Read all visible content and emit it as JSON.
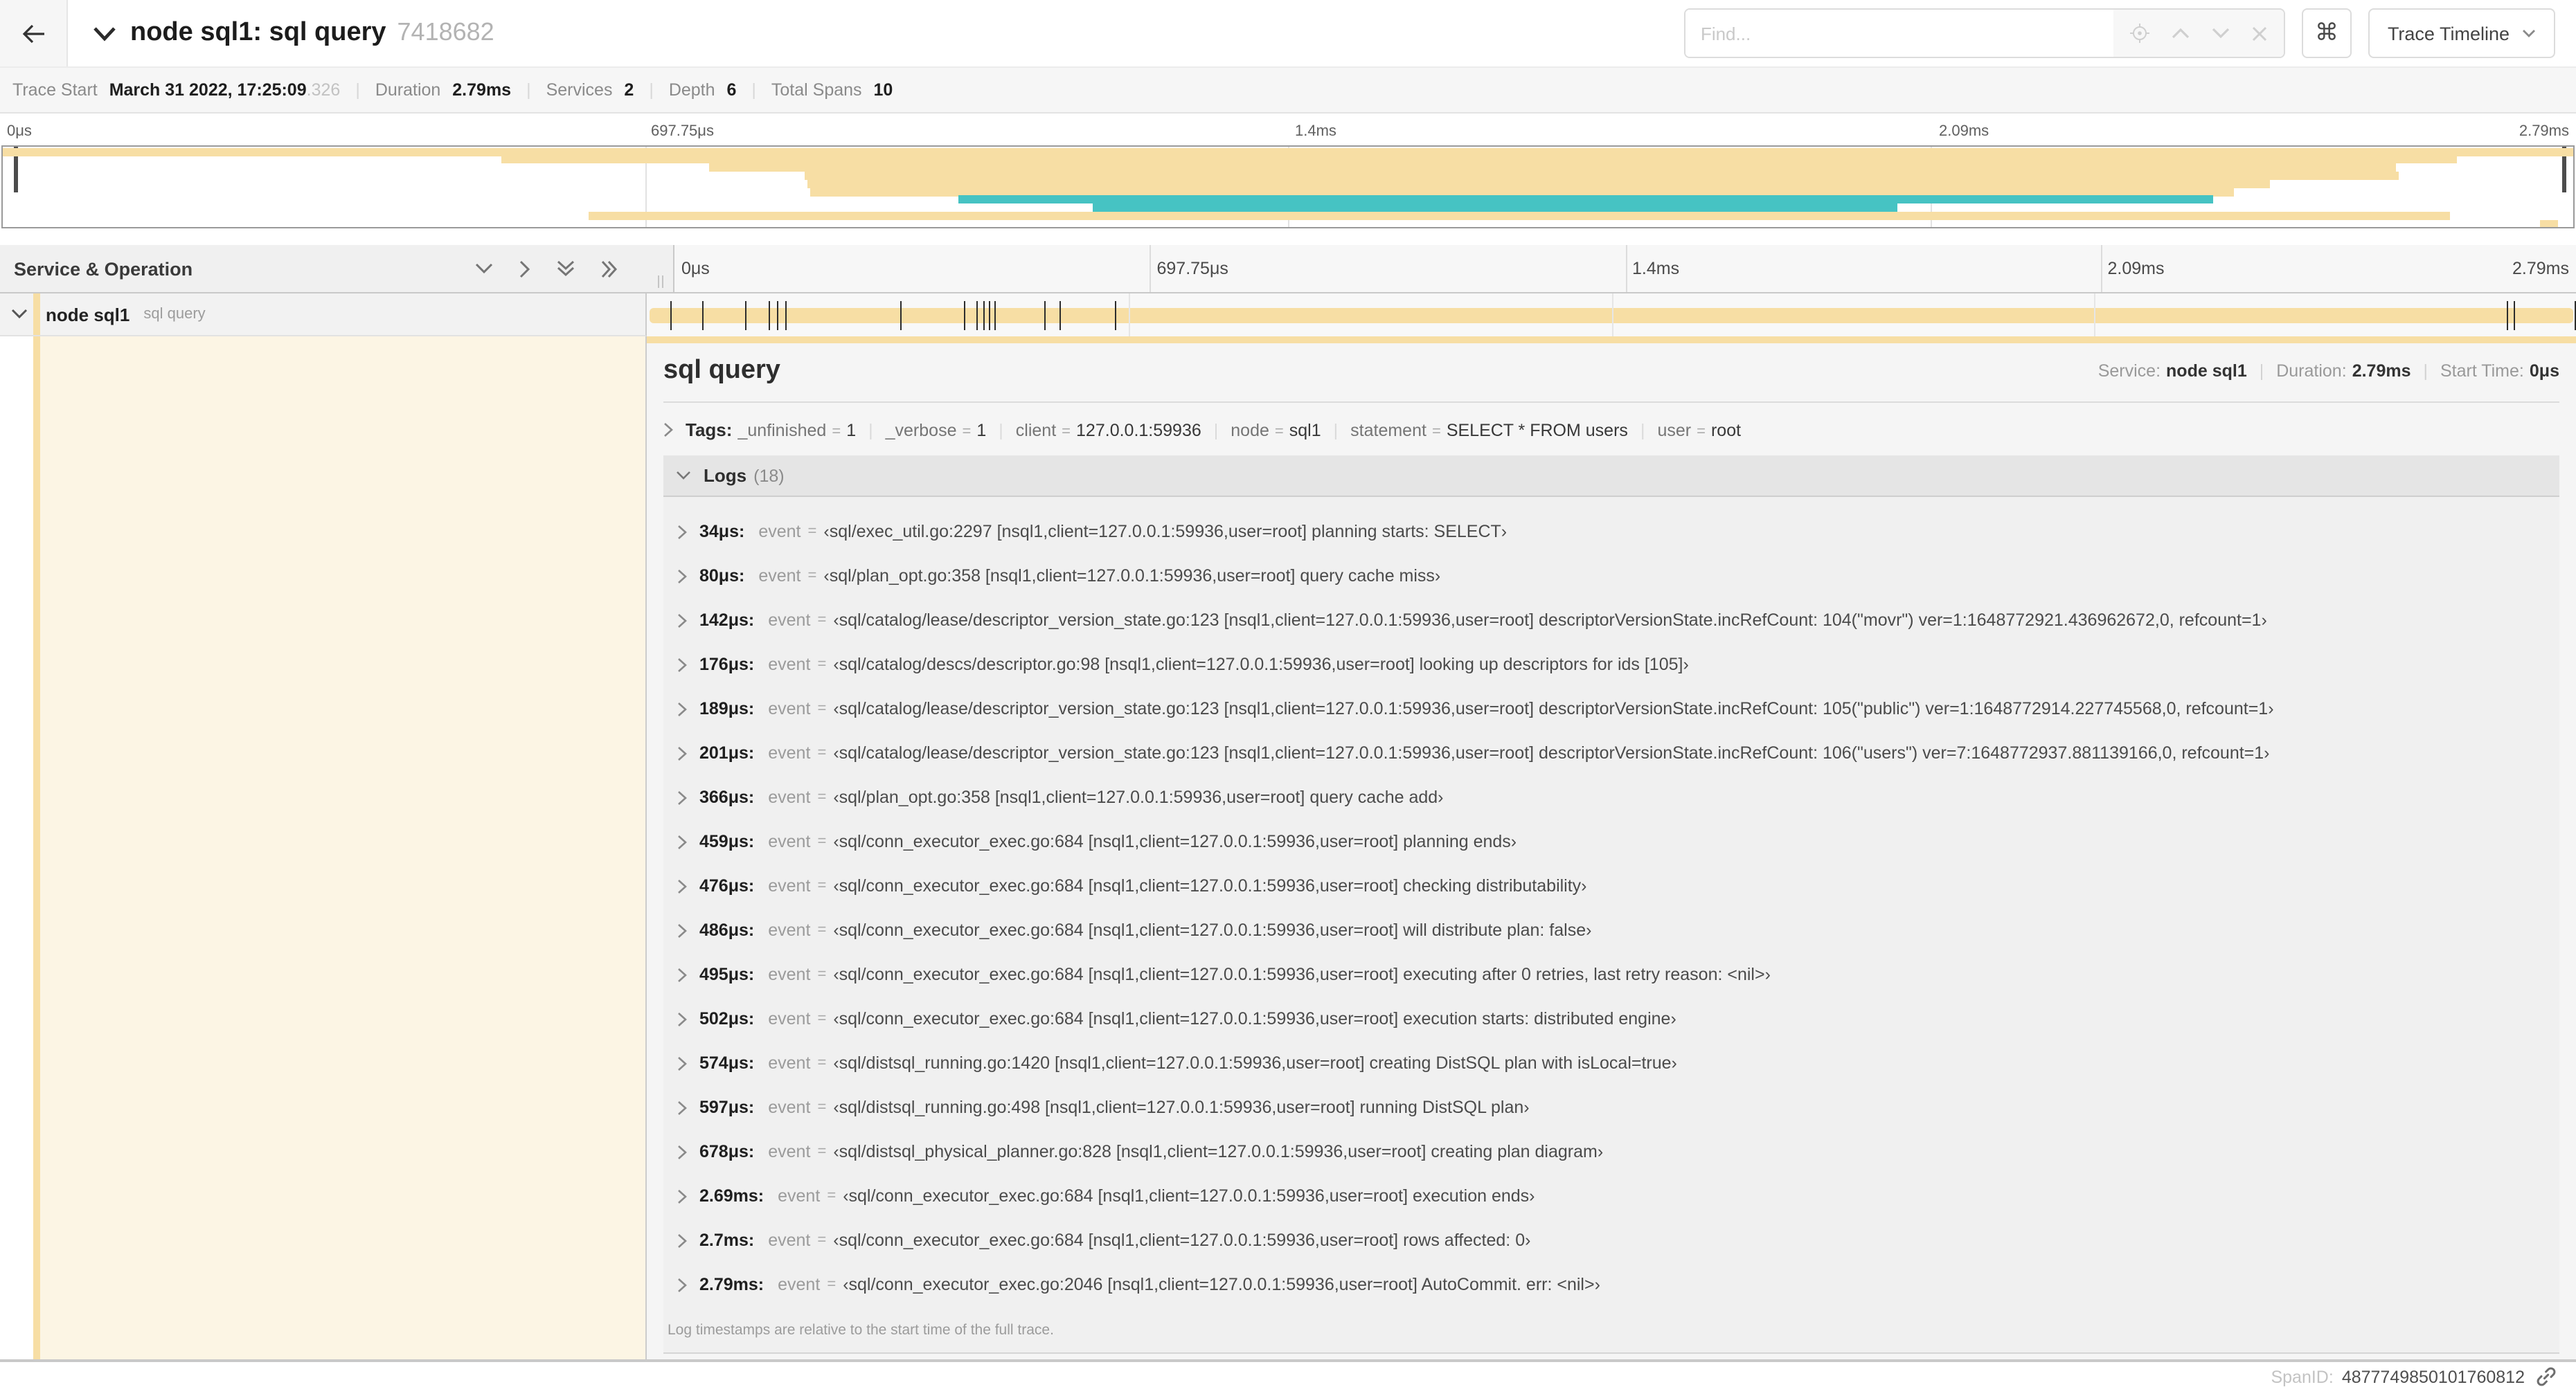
{
  "header": {
    "title": "node sql1: sql query",
    "trace_id_short": "7418682",
    "find_placeholder": "Find...",
    "command_glyph": "⌘",
    "view_selector_label": "Trace Timeline"
  },
  "summary": [
    {
      "label": "Trace Start",
      "value": "March 31 2022, 17:25:09",
      "suffix": ".326"
    },
    {
      "label": "Duration",
      "value": "2.79ms"
    },
    {
      "label": "Services",
      "value": "2"
    },
    {
      "label": "Depth",
      "value": "6"
    },
    {
      "label": "Total Spans",
      "value": "10"
    }
  ],
  "colors": {
    "tan": "#f7dea4",
    "teal": "#46c3c3",
    "cream": "#fcf5e4"
  },
  "timeline": {
    "ticks": [
      {
        "label": "0μs",
        "pos": 0
      },
      {
        "label": "697.75μs",
        "pos": 25
      },
      {
        "label": "1.4ms",
        "pos": 50
      },
      {
        "label": "2.09ms",
        "pos": 75
      },
      {
        "label": "2.79ms",
        "pos": 100
      }
    ],
    "minimap_spans": [
      {
        "left": 0,
        "width": 100,
        "color": "tan"
      },
      {
        "left": 19.4,
        "width": 76.1,
        "color": "tan"
      },
      {
        "left": 27.5,
        "width": 65.6,
        "color": "tan"
      },
      {
        "left": 31.2,
        "width": 62.0,
        "color": "tan"
      },
      {
        "left": 31.3,
        "width": 56.9,
        "color": "tan"
      },
      {
        "left": 31.4,
        "width": 55.4,
        "color": "tan"
      },
      {
        "left": 37.2,
        "width": 48.8,
        "color": "teal"
      },
      {
        "left": 42.4,
        "width": 31.3,
        "color": "teal"
      },
      {
        "left": 22.8,
        "width": 72.4,
        "color": "tan"
      },
      {
        "left": 98.7,
        "width": 0.7,
        "color": "tan"
      }
    ]
  },
  "table": {
    "header_left": "Service & Operation"
  },
  "row": {
    "service": "node sql1",
    "operation": "sql query",
    "log_tick_positions": [
      1.22,
      2.87,
      5.09,
      6.31,
      6.77,
      7.2,
      13.12,
      16.45,
      17.06,
      17.42,
      17.74,
      17.99,
      20.57,
      21.4,
      24.3,
      96.42,
      96.77,
      99.93
    ]
  },
  "detail": {
    "title": "sql query",
    "meta": [
      {
        "label": "Service:",
        "value": "node sql1"
      },
      {
        "label": "Duration:",
        "value": "2.79ms"
      },
      {
        "label": "Start Time:",
        "value": "0μs"
      }
    ],
    "tags_label": "Tags:",
    "tags": [
      {
        "key": "_unfinished",
        "value": "1"
      },
      {
        "key": "_verbose",
        "value": "1"
      },
      {
        "key": "client",
        "value": "127.0.0.1:59936"
      },
      {
        "key": "node",
        "value": "sql1"
      },
      {
        "key": "statement",
        "value": "SELECT * FROM users"
      },
      {
        "key": "user",
        "value": "root"
      }
    ],
    "logs_label": "Logs",
    "logs_count": "(18)",
    "logs": [
      {
        "ts": "34μs:",
        "key": "event",
        "value": "‹sql/exec_util.go:2297 [nsql1,client=127.0.0.1:59936,user=root] planning starts: SELECT›"
      },
      {
        "ts": "80μs:",
        "key": "event",
        "value": "‹sql/plan_opt.go:358 [nsql1,client=127.0.0.1:59936,user=root] query cache miss›"
      },
      {
        "ts": "142μs:",
        "key": "event",
        "value": "‹sql/catalog/lease/descriptor_version_state.go:123 [nsql1,client=127.0.0.1:59936,user=root] descriptorVersionState.incRefCount: 104(\"movr\") ver=1:1648772921.436962672,0, refcount=1›"
      },
      {
        "ts": "176μs:",
        "key": "event",
        "value": "‹sql/catalog/descs/descriptor.go:98 [nsql1,client=127.0.0.1:59936,user=root] looking up descriptors for ids [105]›"
      },
      {
        "ts": "189μs:",
        "key": "event",
        "value": "‹sql/catalog/lease/descriptor_version_state.go:123 [nsql1,client=127.0.0.1:59936,user=root] descriptorVersionState.incRefCount: 105(\"public\") ver=1:1648772914.227745568,0, refcount=1›"
      },
      {
        "ts": "201μs:",
        "key": "event",
        "value": "‹sql/catalog/lease/descriptor_version_state.go:123 [nsql1,client=127.0.0.1:59936,user=root] descriptorVersionState.incRefCount: 106(\"users\") ver=7:1648772937.881139166,0, refcount=1›"
      },
      {
        "ts": "366μs:",
        "key": "event",
        "value": "‹sql/plan_opt.go:358 [nsql1,client=127.0.0.1:59936,user=root] query cache add›"
      },
      {
        "ts": "459μs:",
        "key": "event",
        "value": "‹sql/conn_executor_exec.go:684 [nsql1,client=127.0.0.1:59936,user=root] planning ends›"
      },
      {
        "ts": "476μs:",
        "key": "event",
        "value": "‹sql/conn_executor_exec.go:684 [nsql1,client=127.0.0.1:59936,user=root] checking distributability›"
      },
      {
        "ts": "486μs:",
        "key": "event",
        "value": "‹sql/conn_executor_exec.go:684 [nsql1,client=127.0.0.1:59936,user=root] will distribute plan: false›"
      },
      {
        "ts": "495μs:",
        "key": "event",
        "value": "‹sql/conn_executor_exec.go:684 [nsql1,client=127.0.0.1:59936,user=root] executing after 0 retries, last retry reason: <nil>›"
      },
      {
        "ts": "502μs:",
        "key": "event",
        "value": "‹sql/conn_executor_exec.go:684 [nsql1,client=127.0.0.1:59936,user=root] execution starts: distributed engine›"
      },
      {
        "ts": "574μs:",
        "key": "event",
        "value": "‹sql/distsql_running.go:1420 [nsql1,client=127.0.0.1:59936,user=root] creating DistSQL plan with isLocal=true›"
      },
      {
        "ts": "597μs:",
        "key": "event",
        "value": "‹sql/distsql_running.go:498 [nsql1,client=127.0.0.1:59936,user=root] running DistSQL plan›"
      },
      {
        "ts": "678μs:",
        "key": "event",
        "value": "‹sql/distsql_physical_planner.go:828 [nsql1,client=127.0.0.1:59936,user=root] creating plan diagram›"
      },
      {
        "ts": "2.69ms:",
        "key": "event",
        "value": "‹sql/conn_executor_exec.go:684 [nsql1,client=127.0.0.1:59936,user=root] execution ends›"
      },
      {
        "ts": "2.7ms:",
        "key": "event",
        "value": "‹sql/conn_executor_exec.go:684 [nsql1,client=127.0.0.1:59936,user=root] rows affected: 0›"
      },
      {
        "ts": "2.79ms:",
        "key": "event",
        "value": "‹sql/conn_executor_exec.go:2046 [nsql1,client=127.0.0.1:59936,user=root] AutoCommit. err: <nil>›"
      }
    ],
    "footer_note": "Log timestamps are relative to the start time of the full trace.",
    "span_id_label": "SpanID:",
    "span_id": "4877749850101760812"
  }
}
